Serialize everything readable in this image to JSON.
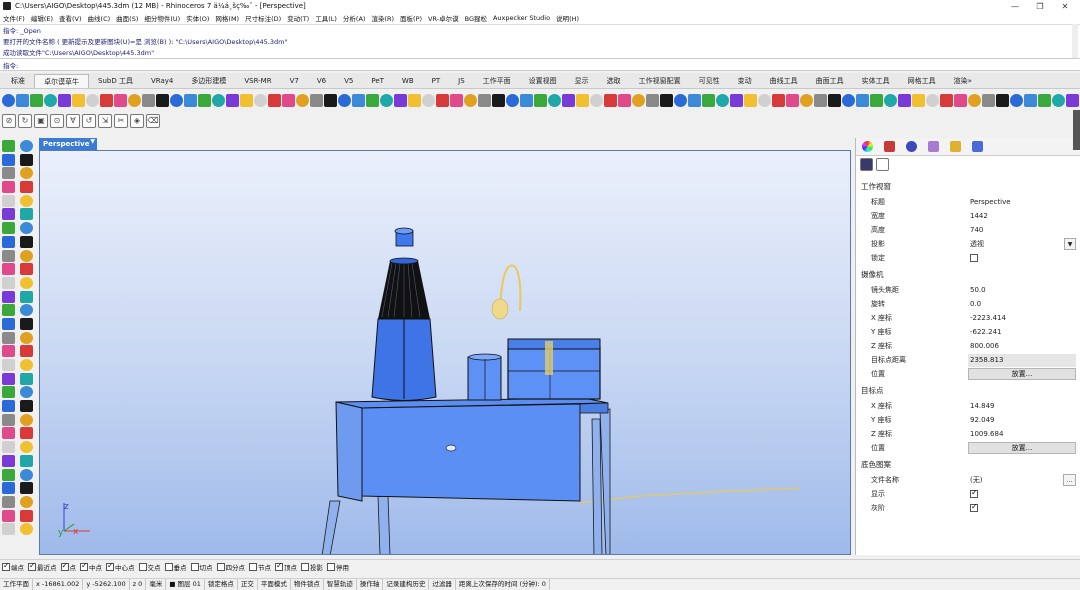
{
  "window": {
    "title": "C:\\Users\\AIGO\\Desktop\\445.3dm (12 MB) - Rhinoceros 7 ä¼á¸šç‰ˆ - [Perspective]",
    "controls": [
      "—",
      "❐",
      "✕"
    ]
  },
  "menu": [
    "文件(F)",
    "编辑(E)",
    "查看(V)",
    "曲线(C)",
    "曲面(S)",
    "细分物件(U)",
    "实体(O)",
    "网格(M)",
    "尺寸标注(D)",
    "变动(T)",
    "工具(L)",
    "分析(A)",
    "渲染(R)",
    "面板(P)",
    "VR-卓尔谟",
    "BG猩松",
    "Auxpecker Studio",
    "说明(H)"
  ],
  "history": [
    "指令: _Open",
    "要打开的文件名称 ( 更新提示及更新图块(U)=是  浏览(B) ): \"C:\\Users\\AIGO\\Desktop\\445.3dm\"",
    "成功读取文件\"C:\\Users\\AIGO\\Desktop\\445.3dm\""
  ],
  "command": {
    "prompt": "指令:",
    "value": ""
  },
  "tabs": [
    "标准",
    "卓尔谟草牛",
    "SubD 工具",
    "VRay4",
    "多边形建模",
    "VSR-MR",
    "V7",
    "V6",
    "V5",
    "PeT",
    "WB",
    "PT",
    "JS",
    "工作平面",
    "设置视图",
    "显示",
    "选取",
    "工作视窗配置",
    "可见性",
    "变动",
    "曲线工具",
    "曲面工具",
    "实体工具",
    "网格工具",
    "渲染»"
  ],
  "active_tab": "卓尔谟草牛",
  "viewport": {
    "label": "Perspective",
    "axis_x": "x",
    "axis_y": "y",
    "axis_z": "z"
  },
  "panel": {
    "section_view": "工作视窗",
    "title_k": "标题",
    "title_v": "Perspective",
    "width_k": "宽度",
    "width_v": "1442",
    "height_k": "高度",
    "height_v": "740",
    "proj_k": "投影",
    "proj_v": "透视",
    "lock_k": "锁定",
    "section_camera": "摄像机",
    "lens_k": "镜头焦距",
    "lens_v": "50.0",
    "rot_k": "旋转",
    "rot_v": "0.0",
    "cx_k": "X 座标",
    "cx_v": "-2223.414",
    "cy_k": "Y 座标",
    "cy_v": "-622.241",
    "cz_k": "Z 座标",
    "cz_v": "800.006",
    "dist_k": "目标点距离",
    "dist_v": "2358.813",
    "pos_k": "位置",
    "pos_btn": "放置...",
    "section_target": "目标点",
    "tx_k": "X 座标",
    "tx_v": "14.849",
    "ty_k": "Y 座标",
    "ty_v": "92.049",
    "tz_k": "Z 座标",
    "tz_v": "1009.684",
    "tpos_k": "位置",
    "tpos_btn": "放置...",
    "section_bg": "底色图案",
    "file_k": "文件名称",
    "file_v": "(无)",
    "file_btn": "...",
    "show_k": "显示",
    "gray_k": "灰阶"
  },
  "osnap": [
    {
      "label": "端点",
      "on": true
    },
    {
      "label": "最近点",
      "on": true
    },
    {
      "label": "点",
      "on": true
    },
    {
      "label": "中点",
      "on": true
    },
    {
      "label": "中心点",
      "on": true
    },
    {
      "label": "交点",
      "on": false
    },
    {
      "label": "垂点",
      "on": false
    },
    {
      "label": "切点",
      "on": false
    },
    {
      "label": "四分点",
      "on": false
    },
    {
      "label": "节点",
      "on": false
    },
    {
      "label": "顶点",
      "on": true
    },
    {
      "label": "投影",
      "on": false
    },
    {
      "label": "停用",
      "on": false
    }
  ],
  "status": [
    "工作平面",
    "x -16861.002",
    "y -5262.100",
    "z 0",
    "毫米",
    "■ 图层 01",
    "锁定格点",
    "正交",
    "平面模式",
    "物件锁点",
    "智慧轨迹",
    "操作轴",
    "记录建构历史",
    "过滤器",
    "距离上次保存的时间 (分钟): 0"
  ]
}
